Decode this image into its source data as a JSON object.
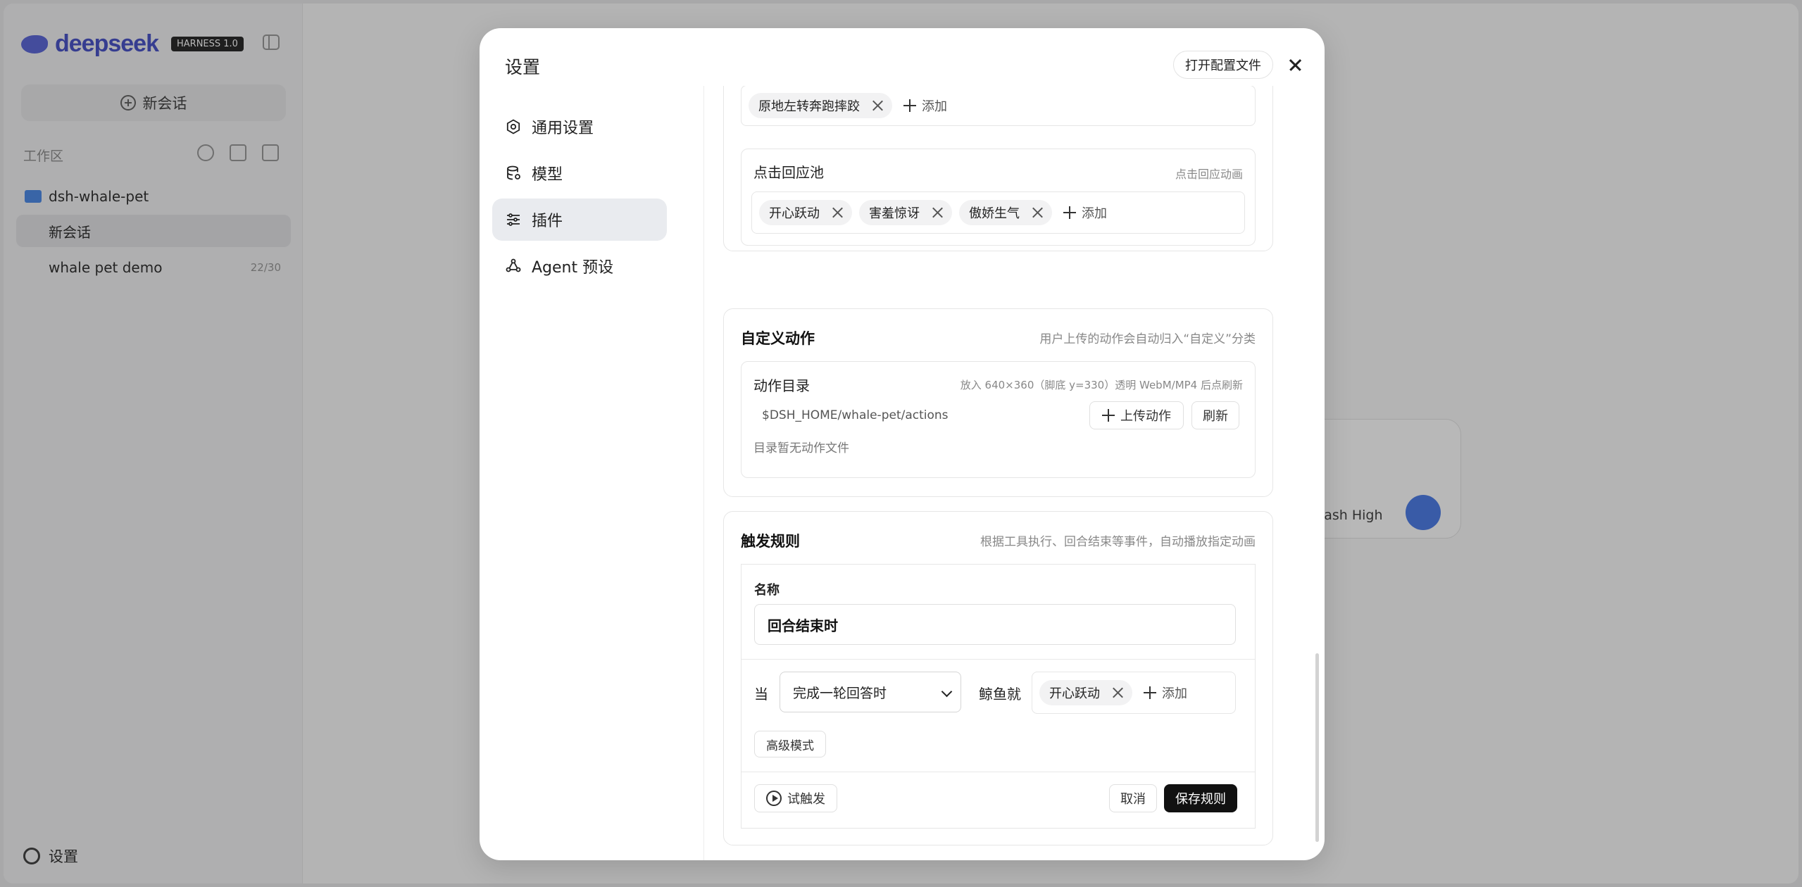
{
  "background": {
    "brand": {
      "name": "deepseek",
      "badge": "HARNESS 1.0"
    },
    "new_chat": "新会话",
    "workspace_label": "工作区",
    "folder": "dsh-whale-pet",
    "items": [
      {
        "label": "新会话",
        "count": ""
      },
      {
        "label": "whale pet demo",
        "count": "22/30"
      }
    ],
    "settings_label": "设置",
    "composer_model": "Flash High"
  },
  "modal": {
    "title": "设置",
    "open_config": "打开配置文件",
    "nav": [
      {
        "label": "通用设置",
        "icon": "gear-icon"
      },
      {
        "label": "模型",
        "icon": "database-icon"
      },
      {
        "label": "插件",
        "icon": "sliders-icon",
        "active": true
      },
      {
        "label": "Agent 预设",
        "icon": "agent-icon"
      }
    ],
    "top_pool": {
      "chips": [
        "原地左转奔跑摔跤"
      ],
      "add": "添加"
    },
    "click_pool": {
      "label": "点击回应池",
      "hint": "点击回应动画",
      "chips": [
        "开心跃动",
        "害羞惊讶",
        "傲娇生气"
      ],
      "add": "添加"
    },
    "custom_actions": {
      "title": "自定义动作",
      "desc": "用户上传的动作会自动归入“自定义”分类",
      "dir_label": "动作目录",
      "dir_hint": "放入 640×360（脚底 y=330）透明 WebM/MP4 后点刷新",
      "path": "$DSH_HOME/whale-pet/actions",
      "upload": "上传动作",
      "refresh": "刷新",
      "empty": "目录暂无动作文件"
    },
    "triggers": {
      "title": "触发规则",
      "desc": "根据工具执行、回合结束等事件，自动播放指定动画",
      "name_label": "名称",
      "name_value": "回合结束时",
      "when_label": "当",
      "when_value": "完成一轮回答时",
      "then_label": "鲸鱼就",
      "chips": [
        "开心跃动"
      ],
      "add": "添加",
      "advanced": "高级模式",
      "test": "试触发",
      "cancel": "取消",
      "save": "保存规则"
    }
  },
  "colors": {
    "accent": "#111111",
    "brand": "#4b55c8",
    "active_nav": "#e9ebef"
  }
}
